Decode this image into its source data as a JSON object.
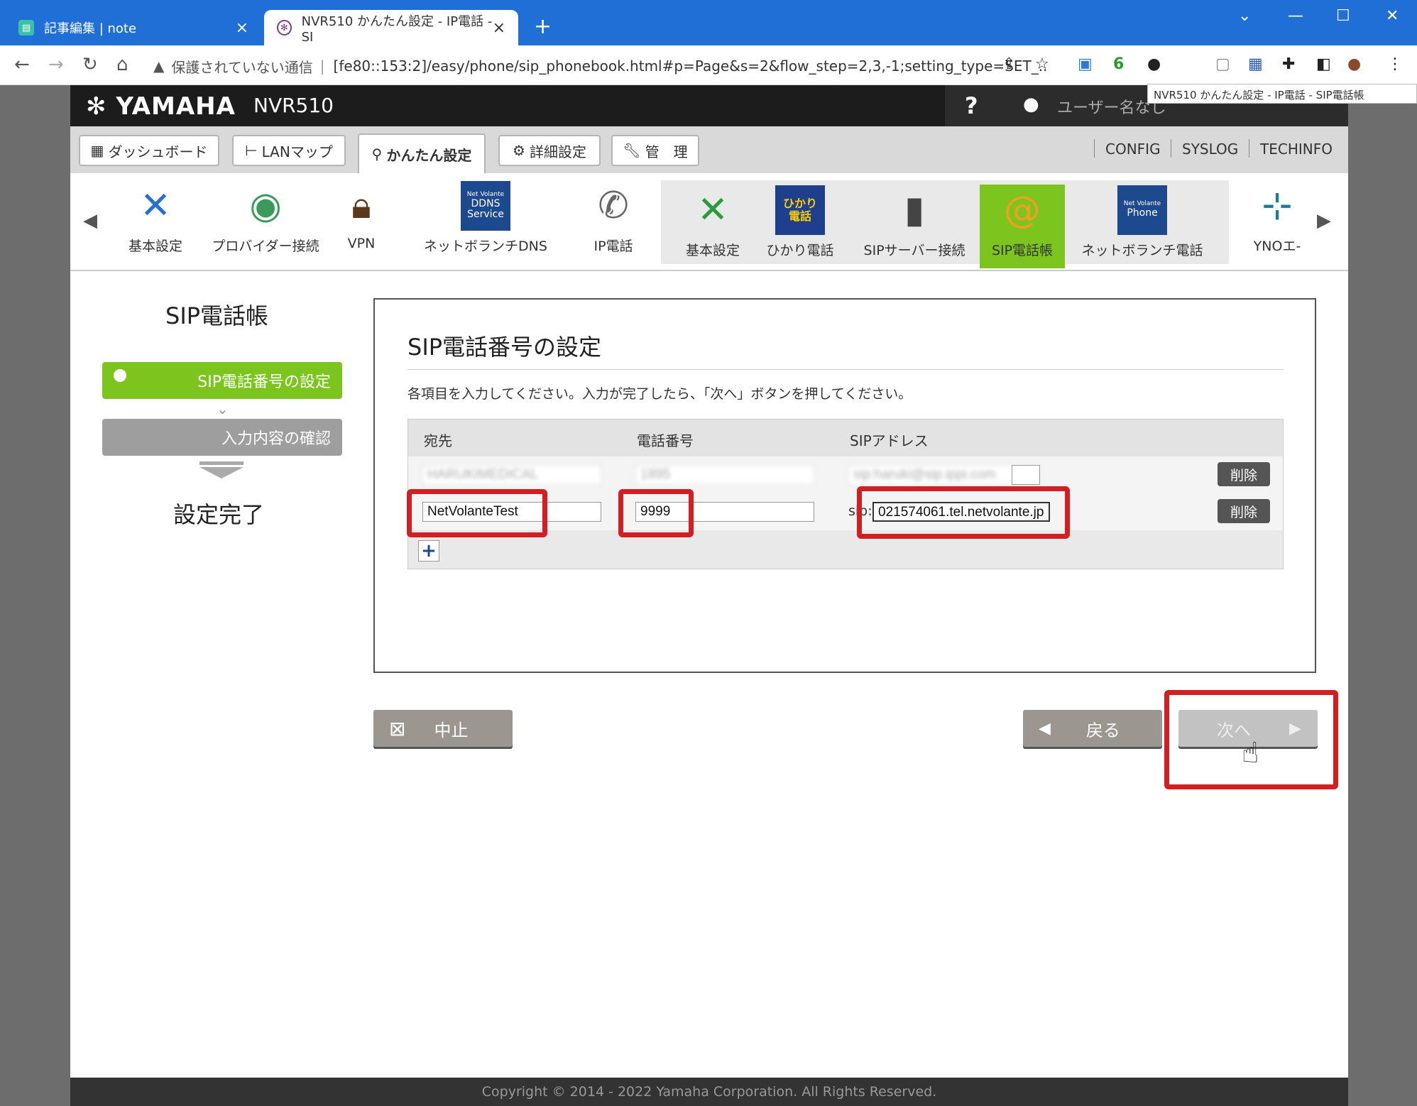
{
  "browser": {
    "tabs": [
      {
        "title": "記事編集 | note"
      },
      {
        "title": "NVR510 かんたん設定 - IP電話 - SI"
      }
    ],
    "security_label": "保護されていない通信",
    "url": "[fe80::153:2]/easy/phone/sip_phonebook.html#p=Page&s=2&flow_step=2,3,-1;setting_type=SET_...",
    "ext_badge": "6",
    "tooltip": "NVR510 かんたん設定 - IP電話 - SIP電話帳"
  },
  "router": {
    "brand": "YAMAHA",
    "model": "NVR510",
    "help": "?",
    "user": "ユーザー名なし"
  },
  "menu": {
    "tabs": [
      "ダッシュボード",
      "LANマップ",
      "かんたん設定",
      "詳細設定",
      "管　理"
    ],
    "links": [
      "CONFIG",
      "SYSLOG",
      "TECHINFO"
    ]
  },
  "icons": [
    {
      "label": "基本設定"
    },
    {
      "label": "プロバイダー接続"
    },
    {
      "label": "VPN"
    },
    {
      "label": "ネットボランチDNS",
      "badge": [
        "Net Volante",
        "DDNS",
        "Service"
      ]
    },
    {
      "label": "IP電話"
    },
    {
      "label": "基本設定"
    },
    {
      "label": "ひかり電話",
      "badge": [
        "ひかり",
        "電話"
      ]
    },
    {
      "label": "SIPサーバー接続"
    },
    {
      "label": "SIP電話帳"
    },
    {
      "label": "ネットボランチ電話",
      "badge": [
        "Net Volante",
        "Phone"
      ]
    },
    {
      "label": "YNOエ-"
    }
  ],
  "sidebar": {
    "title": "SIP電話帳",
    "steps": [
      "SIP電話番号の設定",
      "入力内容の確認",
      "設定完了"
    ]
  },
  "form": {
    "title": "SIP電話番号の設定",
    "description": "各項目を入力してください。入力が完了したら、「次へ」ボタンを押してください。",
    "columns": [
      "宛先",
      "電話番号",
      "SIPアドレス"
    ],
    "rows": [
      {
        "name": "HARUKIMEDICAL",
        "number": "1895",
        "sip": "sip:haruki@sip.ippi.com",
        "delete": "削除"
      },
      {
        "name": "NetVolanteTest",
        "number": "9999",
        "sip_prefix": "sip:",
        "sip": "021574061.tel.netvolante.jp",
        "delete": "削除"
      }
    ],
    "add": "+"
  },
  "buttons": {
    "cancel": "中止",
    "back": "戻る",
    "next": "次へ"
  },
  "footer": "Copyright © 2014 - 2022 Yamaha Corporation. All Rights Reserved."
}
